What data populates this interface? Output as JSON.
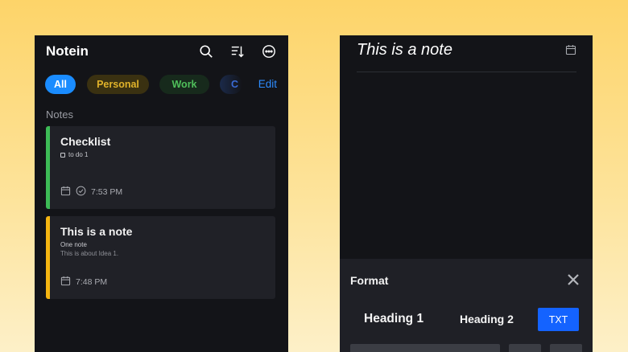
{
  "left": {
    "app_title": "Notein",
    "chips": {
      "all": "All",
      "personal": "Personal",
      "work": "Work",
      "partial": "C"
    },
    "edit_label": "Edit",
    "section_label": "Notes",
    "notes": [
      {
        "title": "Checklist",
        "line1": "to do 1",
        "line2": "",
        "time": "7:53 PM",
        "accent": "#3dbb56"
      },
      {
        "title": "This is a note",
        "line1": "One note",
        "line2": "This is about Idea 1.",
        "time": "7:48 PM",
        "accent": "#f5b511"
      }
    ],
    "icons": [
      "search-icon",
      "sort-icon",
      "more-icon",
      "calendar-icon",
      "check-circle-icon"
    ]
  },
  "right": {
    "note_title": "This is a note",
    "format": {
      "title": "Format",
      "heading1": "Heading 1",
      "heading2": "Heading 2",
      "txt": "TXT"
    },
    "icons": [
      "calendar-icon",
      "close-icon"
    ]
  },
  "colors": {
    "accent_blue": "#1a8cff",
    "background": "#131418",
    "card": "#202127"
  }
}
